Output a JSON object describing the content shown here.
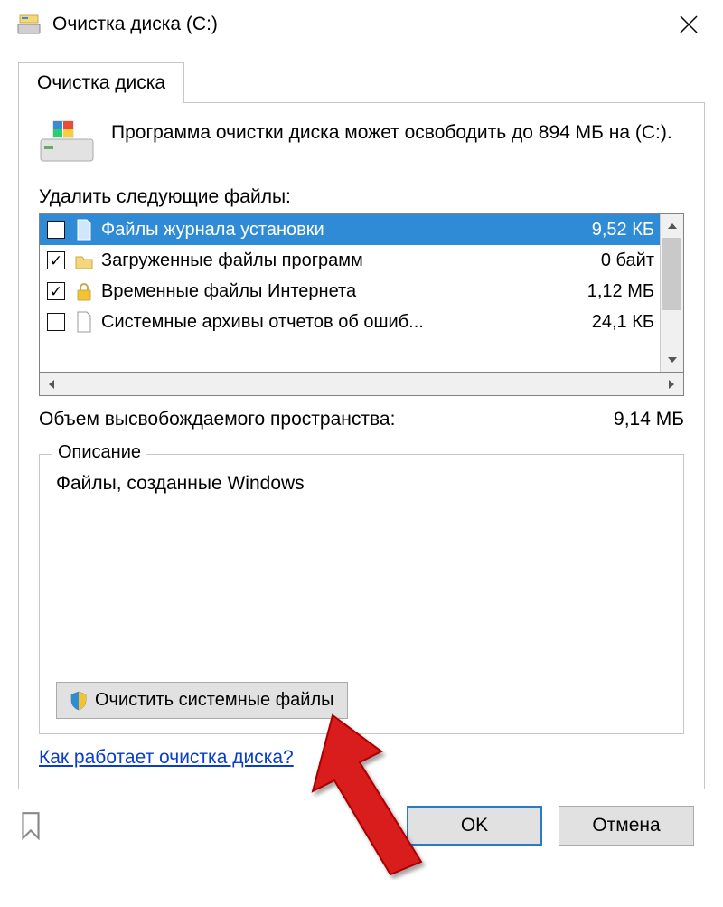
{
  "window": {
    "title": "Очистка диска  (C:)"
  },
  "tabs": {
    "cleanup_label": "Очистка диска"
  },
  "intro": {
    "text": "Программа очистки диска может освободить до 894 МБ на  (C:)."
  },
  "list": {
    "label": "Удалить следующие файлы:",
    "items": [
      {
        "checked": false,
        "icon": "page-blue",
        "name": "Файлы журнала установки",
        "size": "9,52 КБ",
        "selected": true
      },
      {
        "checked": true,
        "icon": "folder",
        "name": "Загруженные файлы программ",
        "size": "0 байт",
        "selected": false
      },
      {
        "checked": true,
        "icon": "lock",
        "name": "Временные файлы Интернета",
        "size": "1,12 МБ",
        "selected": false
      },
      {
        "checked": false,
        "icon": "page",
        "name": "Системные архивы отчетов об ошиб...",
        "size": "24,1 КБ",
        "selected": false
      }
    ]
  },
  "total": {
    "label": "Объем высвобождаемого пространства:",
    "value": "9,14 МБ"
  },
  "description": {
    "group_label": "Описание",
    "text": "Файлы, созданные Windows",
    "clean_system_button": "Очистить системные файлы"
  },
  "link": {
    "how_works": "Как работает очистка диска?"
  },
  "buttons": {
    "ok": "OK",
    "cancel": "Отмена"
  }
}
